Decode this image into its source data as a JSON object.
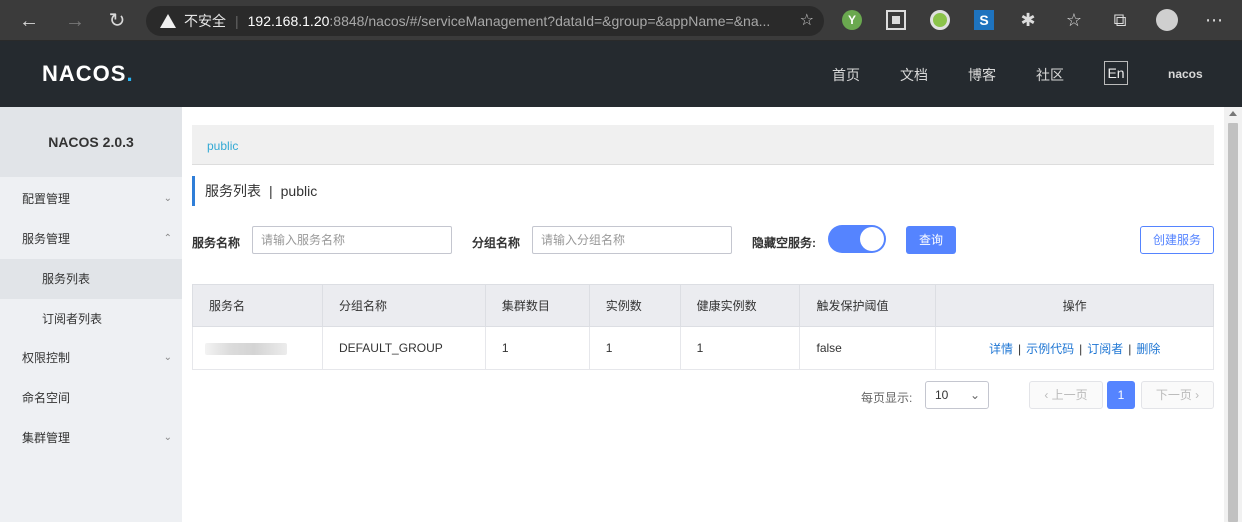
{
  "browser": {
    "security_label": "不安全",
    "url_host": "192.168.1.20",
    "url_rest": ":8848/nacos/#/serviceManagement?dataId=&group=&appName=&na..."
  },
  "header": {
    "logo": "NACOS",
    "logo_dot": ".",
    "nav": [
      "首页",
      "文档",
      "博客",
      "社区"
    ],
    "lang": "En",
    "user": "nacos"
  },
  "sidebar": {
    "title": "NACOS 2.0.3",
    "items": [
      {
        "label": "配置管理"
      },
      {
        "label": "服务管理"
      },
      {
        "label": "服务列表"
      },
      {
        "label": "订阅者列表"
      },
      {
        "label": "权限控制"
      },
      {
        "label": "命名空间"
      },
      {
        "label": "集群管理"
      }
    ]
  },
  "main": {
    "namespace": "public",
    "title": "服务列表",
    "title_sep": "|",
    "title_ns": "public",
    "filters": {
      "service_label": "服务名称",
      "service_placeholder": "请输入服务名称",
      "group_label": "分组名称",
      "group_placeholder": "请输入分组名称",
      "hide_empty_label": "隐藏空服务:",
      "hide_empty_on": true,
      "query_button": "查询",
      "create_button": "创建服务"
    },
    "table": {
      "headers": [
        "服务名",
        "分组名称",
        "集群数目",
        "实例数",
        "健康实例数",
        "触发保护阈值",
        "操作"
      ],
      "rows": [
        {
          "service": "",
          "group": "DEFAULT_GROUP",
          "clusters": "1",
          "instances": "1",
          "healthy": "1",
          "threshold": "false",
          "actions": [
            "详情",
            "示例代码",
            "订阅者",
            "删除"
          ]
        }
      ]
    },
    "pagination": {
      "page_size_label": "每页显示:",
      "page_size": "10",
      "prev": "上一页",
      "current": "1",
      "next": "下一页"
    }
  }
}
